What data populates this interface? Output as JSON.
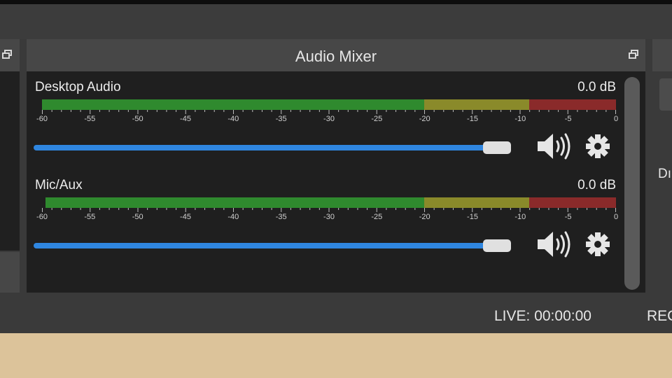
{
  "mixer": {
    "title": "Audio Mixer",
    "channels": [
      {
        "name": "Desktop Audio",
        "level": "0.0 dB",
        "volume_fraction": 0.97,
        "peak_fraction": 0.0
      },
      {
        "name": "Mic/Aux",
        "level": "0.0 dB",
        "volume_fraction": 0.97,
        "peak_fraction": 0.01
      }
    ],
    "scale_ticks": [
      "-60",
      "-55",
      "-50",
      "-45",
      "-40",
      "-35",
      "-30",
      "-25",
      "-20",
      "-15",
      "-10",
      "-5",
      "0"
    ]
  },
  "right_dock": {
    "partial_text": "Dı"
  },
  "status": {
    "live": "LIVE: 00:00:00",
    "rec_partial": "REC"
  },
  "icons": {
    "dock_undock": "float-window-icon",
    "mute": "speaker-icon",
    "settings": "gear-icon"
  },
  "colors": {
    "meter_green": "#2f8a2e",
    "meter_yellow": "#8a8a2a",
    "meter_red": "#8a2a2a",
    "slider_blue": "#2f86e0"
  }
}
